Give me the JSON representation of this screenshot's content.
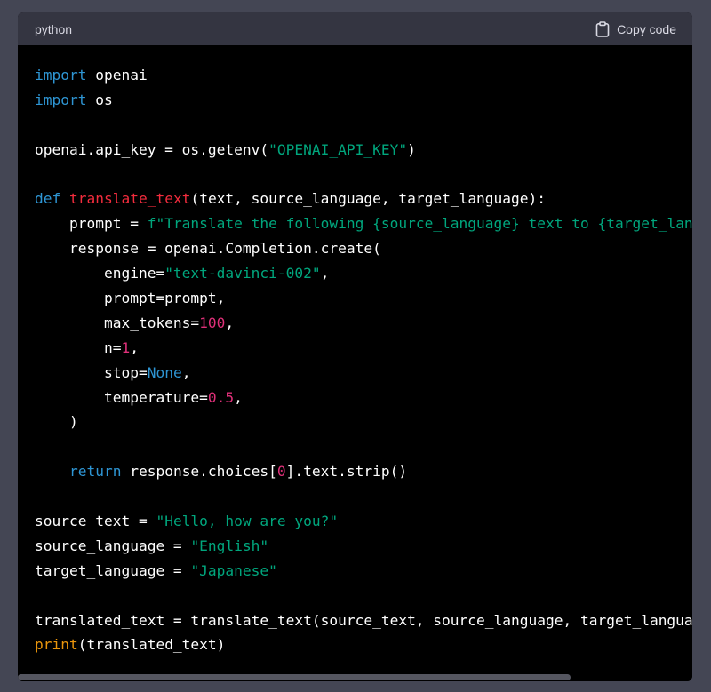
{
  "header": {
    "language": "python",
    "copy_label": "Copy code",
    "copy_icon": "clipboard-icon"
  },
  "code": {
    "lines": [
      [
        {
          "t": "import",
          "c": "kw"
        },
        {
          "t": " openai",
          "c": ""
        }
      ],
      [
        {
          "t": "import",
          "c": "kw"
        },
        {
          "t": " os",
          "c": ""
        }
      ],
      [],
      [
        {
          "t": "openai.api_key = os.getenv(",
          "c": ""
        },
        {
          "t": "\"OPENAI_API_KEY\"",
          "c": "str"
        },
        {
          "t": ")",
          "c": ""
        }
      ],
      [],
      [
        {
          "t": "def",
          "c": "kw"
        },
        {
          "t": " ",
          "c": ""
        },
        {
          "t": "translate_text",
          "c": "fn"
        },
        {
          "t": "(text, source_language, target_language):",
          "c": ""
        }
      ],
      [
        {
          "t": "    prompt = ",
          "c": ""
        },
        {
          "t": "f\"Translate the following {source_language} text to {target_language}: {text}\"",
          "c": "str"
        }
      ],
      [
        {
          "t": "    response = openai.Completion.create(",
          "c": ""
        }
      ],
      [
        {
          "t": "        engine=",
          "c": ""
        },
        {
          "t": "\"text-davinci-002\"",
          "c": "str"
        },
        {
          "t": ",",
          "c": ""
        }
      ],
      [
        {
          "t": "        prompt=prompt,",
          "c": ""
        }
      ],
      [
        {
          "t": "        max_tokens=",
          "c": ""
        },
        {
          "t": "100",
          "c": "num"
        },
        {
          "t": ",",
          "c": ""
        }
      ],
      [
        {
          "t": "        n=",
          "c": ""
        },
        {
          "t": "1",
          "c": "num"
        },
        {
          "t": ",",
          "c": ""
        }
      ],
      [
        {
          "t": "        stop=",
          "c": ""
        },
        {
          "t": "None",
          "c": "kw"
        },
        {
          "t": ",",
          "c": ""
        }
      ],
      [
        {
          "t": "        temperature=",
          "c": ""
        },
        {
          "t": "0.5",
          "c": "num"
        },
        {
          "t": ",",
          "c": ""
        }
      ],
      [
        {
          "t": "    )",
          "c": ""
        }
      ],
      [],
      [
        {
          "t": "    ",
          "c": ""
        },
        {
          "t": "return",
          "c": "kw"
        },
        {
          "t": " response.choices[",
          "c": ""
        },
        {
          "t": "0",
          "c": "num"
        },
        {
          "t": "].text.strip()",
          "c": ""
        }
      ],
      [],
      [
        {
          "t": "source_text = ",
          "c": ""
        },
        {
          "t": "\"Hello, how are you?\"",
          "c": "str"
        }
      ],
      [
        {
          "t": "source_language = ",
          "c": ""
        },
        {
          "t": "\"English\"",
          "c": "str"
        }
      ],
      [
        {
          "t": "target_language = ",
          "c": ""
        },
        {
          "t": "\"Japanese\"",
          "c": "str"
        }
      ],
      [],
      [
        {
          "t": "translated_text = translate_text(source_text, source_language, target_language)",
          "c": ""
        }
      ],
      [
        {
          "t": "print",
          "c": "bi"
        },
        {
          "t": "(translated_text)",
          "c": ""
        }
      ]
    ]
  },
  "scrollbar": {
    "visible_fraction": 0.82
  },
  "colors": {
    "page_bg": "#444654",
    "header_bg": "#343541",
    "code_bg": "#000000",
    "keyword": "#2e95d3",
    "function": "#f22c3d",
    "string": "#00a67d",
    "number": "#df3079",
    "builtin": "#e9950c"
  }
}
